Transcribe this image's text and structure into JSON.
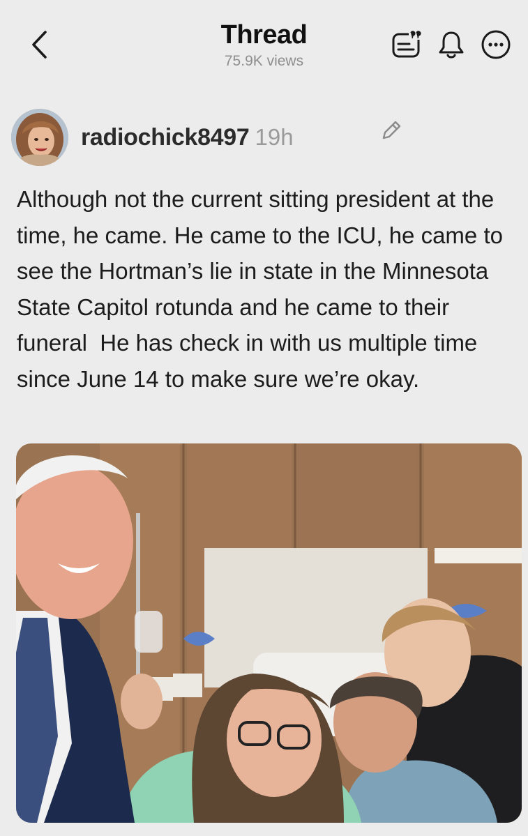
{
  "header": {
    "title": "Thread",
    "views": "75.9K views"
  },
  "icons": {
    "back": "chevron-left-icon",
    "summary": "thread-summary-icon",
    "notify": "bell-icon",
    "more": "more-options-icon",
    "edit": "pencil-icon"
  },
  "post": {
    "author": "radiochick8497",
    "time": "19h",
    "text": "Although not the current sitting president at the time, he came. He came to the ICU, he came to see the Hortman’s lie in state in the Minnesota State Capitol rotunda and he came to their funeral  He has check in with us multiple time since June 14 to make sure we’re okay."
  },
  "colors": {
    "background": "#ececec",
    "text": "#1c1c1c",
    "muted": "#9a9a9a"
  }
}
